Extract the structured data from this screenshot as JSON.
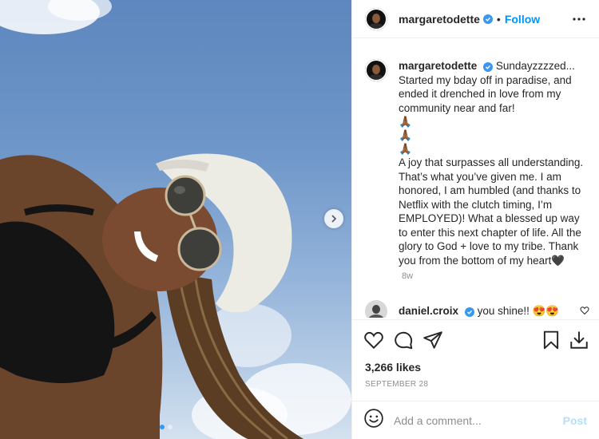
{
  "post": {
    "author": "margaretodette",
    "separator": "•",
    "follow_label": "Follow",
    "more_icon": "more-horizontal-icon"
  },
  "caption": {
    "author": "margaretodette",
    "line1": "Sundayzzzzed... Started my bday off in paradise, and ended it drenched in love from my community near and far!",
    "emoji": [
      "🙏🏾",
      "🙏🏾",
      "🙏🏾"
    ],
    "line2": "A joy that surpasses all understanding. That’s what you’ve given me. I am honored, I am humbled (and thanks to Netflix with the clutch timing, I’m EMPLOYED)! What a blessed up way to enter this next chapter of life. All the glory to God + love to my tribe. Thank you from the bottom of my heart🖤",
    "time": "8w"
  },
  "comment": {
    "author": "daniel.croix",
    "text": "you shine!! 😍😍"
  },
  "stats": {
    "likes": "3,266 likes",
    "date": "SEPTEMBER 28"
  },
  "composer": {
    "placeholder": "Add a comment...",
    "post_label": "Post"
  },
  "colors": {
    "accent": "#0095f6",
    "verified": "#3897f0",
    "muted": "#8e8e8e",
    "post_disabled": "#b2dffc"
  }
}
